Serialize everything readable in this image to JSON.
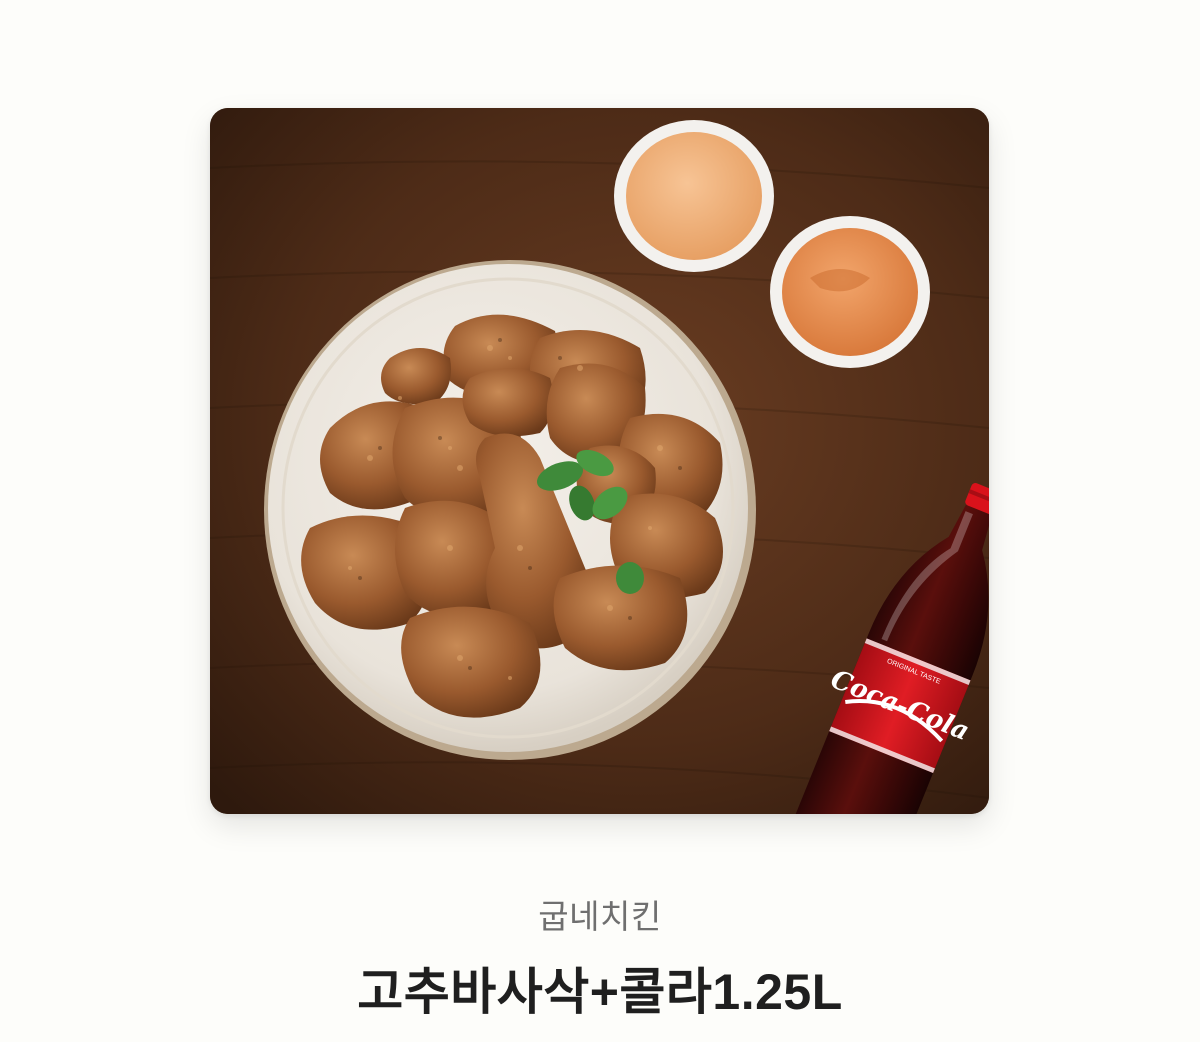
{
  "product": {
    "brand": "굽네치킨",
    "name": "고추바사삭+콜라1.25L",
    "image_icon": "chicken-cola-photo",
    "bottle_logo": "Coca-Cola",
    "bottle_small_text": "ORIGINAL TASTE"
  },
  "colors": {
    "background": "#fdfdfa",
    "brand_text": "#6f6f6f",
    "title_text": "#1f1f1f",
    "table_wood": "#4a2a17",
    "cola_red": "#d6121c"
  }
}
